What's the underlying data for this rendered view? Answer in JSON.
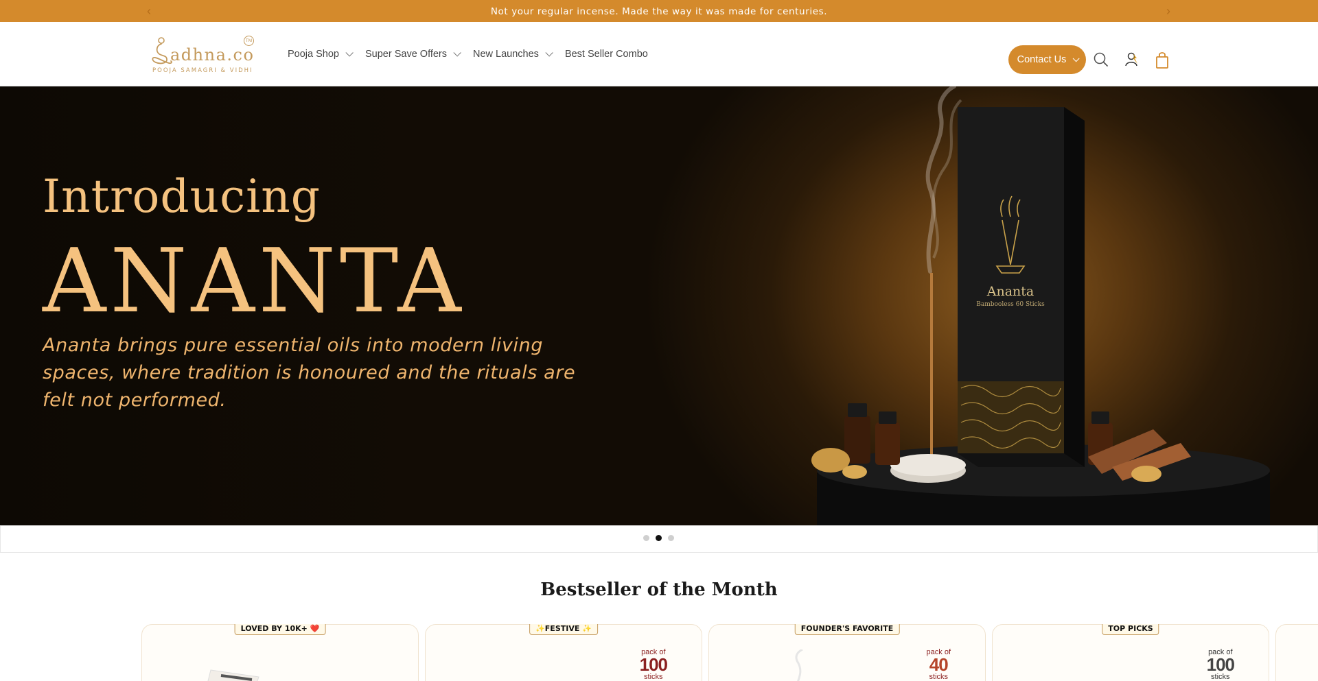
{
  "announcement": {
    "text": "Not your regular incense. Made the way it was made for centuries.",
    "prev_glyph": "‹",
    "next_glyph": "›"
  },
  "logo": {
    "wordmark": "adhna.co",
    "tagline": "POOJA SAMAGRI & VIDHI",
    "tm": "TM"
  },
  "nav": {
    "items": [
      {
        "label": "Pooja Shop",
        "dropdown": true
      },
      {
        "label": "Super Save Offers",
        "dropdown": true
      },
      {
        "label": "New Launches",
        "dropdown": true
      },
      {
        "label": "Best Seller Combo",
        "dropdown": false
      }
    ]
  },
  "header_actions": {
    "contact_label": "Contact Us",
    "icons": [
      "search-icon",
      "account-icon",
      "cart-icon"
    ]
  },
  "hero": {
    "intro": "Introducing",
    "title": "ANANTA",
    "description": "Ananta brings pure essential oils into modern living spaces, where tradition is honoured and the rituals are felt not performed.",
    "product_box_name": "Ananta",
    "product_box_sub": "Bambooless 60 Sticks"
  },
  "slider": {
    "count": 3,
    "active_index": 1
  },
  "bestsellers": {
    "title": "Bestseller of the Month",
    "cards": [
      {
        "badge": "LOVED BY 10K+ ❤️",
        "pack_of": "",
        "pack_num": "",
        "pack_unit": ""
      },
      {
        "badge": "✨FESTIVE ✨",
        "pack_of": "pack of",
        "pack_num": "100",
        "pack_unit": "sticks"
      },
      {
        "badge": "FOUNDER'S FAVORITE",
        "pack_of": "pack of",
        "pack_num": "40",
        "pack_unit": "sticks"
      },
      {
        "badge": "TOP PICKS",
        "pack_of": "pack of",
        "pack_num": "100",
        "pack_unit": "sticks"
      }
    ]
  },
  "colors": {
    "accent": "#d48a2c",
    "gold_text": "#f5c27f",
    "logo_gold": "#c49a5c",
    "pack_red": "#8a1f1f"
  }
}
